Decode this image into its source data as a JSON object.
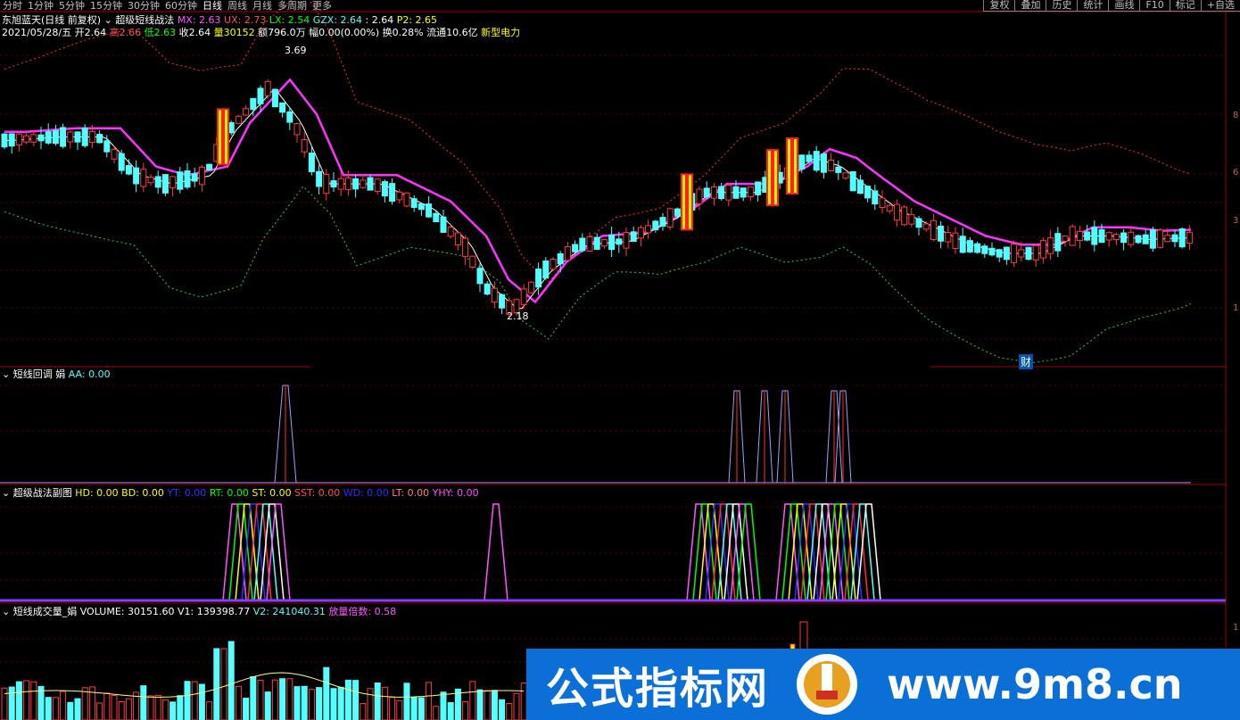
{
  "periods": [
    "分时",
    "1分钟",
    "5分钟",
    "15分钟",
    "30分钟",
    "60分钟",
    "日线",
    "周线",
    "月线",
    "多周期",
    "更多"
  ],
  "active_period": "日线",
  "toolbar": [
    "复权",
    "叠加",
    "历史",
    "统计",
    "画线",
    "F10",
    "标记",
    "+自选"
  ],
  "header": {
    "stock": "东旭蓝天(日线 前复权)",
    "indicator": "超级短线战法",
    "mx": "MX: 2.63",
    "ux": "UX: 2.73",
    "lx": "LX: 2.54",
    "gzx": "GZX: 2.64",
    "colon": ": 2.64",
    "p2": "P2: 2.65"
  },
  "quote": {
    "date": "2021/05/28/五",
    "open_label": "开",
    "open": "2.64",
    "high_label": "高",
    "high": "2.66",
    "low_label": "低",
    "low": "2.63",
    "close_label": "收",
    "close": "2.64",
    "vol_label": "量",
    "vol": "30152",
    "amount": "额796.0万",
    "change": "幅0.00(0.00%)",
    "turnover": "换0.28%",
    "float": "流通10.6亿",
    "sector": "新型电力"
  },
  "price_marks": {
    "high": "3.69",
    "low": "2.18"
  },
  "cai_label": "财",
  "panel2": {
    "name": "短线回调 娟",
    "aa": "AA: 0.00"
  },
  "panel3": {
    "name": "超级战法副图",
    "hd": "HD: 0.00",
    "bd": "BD: 0.00",
    "yt": "YT: 0.00",
    "rt": "RT: 0.00",
    "st": "ST: 0.00",
    "sst": "SST: 0.00",
    "wd": "WD: 0.00",
    "lt": "LT: 0.00",
    "yhy": "YHY: 0.00"
  },
  "panel4": {
    "name": "短线成交量_娟",
    "volume": "VOLUME: 30151.60",
    "v1": "V1: 139398.77",
    "v2": "V2: 241040.31",
    "ratio": "放量倍数: 0.58"
  },
  "right_axis": [
    "8",
    "6",
    "3",
    "1",
    "1"
  ],
  "watermark": {
    "title": "公式指标网",
    "url": "www.9m8.cn"
  },
  "colors": {
    "up": "#ff3c3c",
    "down": "#54ffff",
    "ma": "#ff33ff",
    "mid": "#ffffff"
  }
}
